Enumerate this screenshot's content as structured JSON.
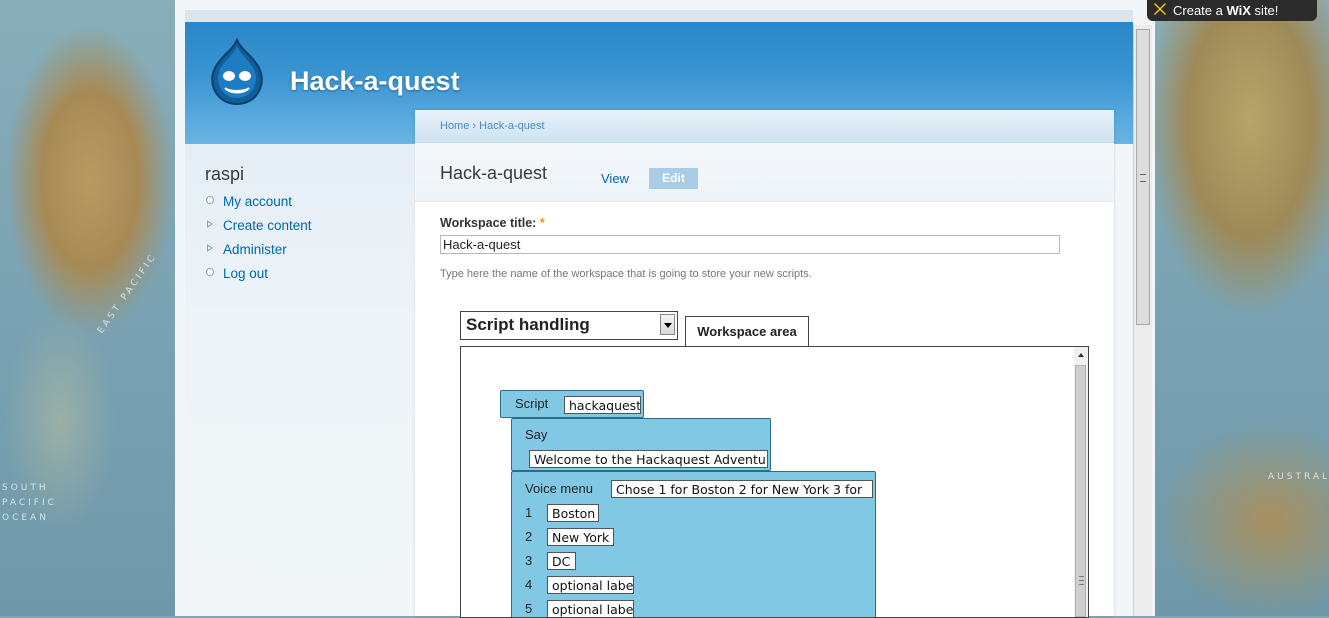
{
  "site": {
    "name": "Hack-a-quest"
  },
  "wix_badge": {
    "prefix": "Create a ",
    "brand": "WiX",
    "suffix": " site!"
  },
  "map_labels": [
    "SOUTH",
    "PACIFIC",
    "OCEAN",
    "EAST PACIFIC",
    "AUSTRALIA"
  ],
  "sidebar": {
    "user": "raspi",
    "items": [
      {
        "label": "My account",
        "bullet": "circle"
      },
      {
        "label": "Create content",
        "bullet": "triangle"
      },
      {
        "label": "Administer",
        "bullet": "triangle"
      },
      {
        "label": "Log out",
        "bullet": "circle"
      }
    ]
  },
  "breadcrumb": {
    "home": "Home",
    "separator": "›",
    "current": "Hack-a-quest"
  },
  "page": {
    "title": "Hack-a-quest",
    "tabs": {
      "view": "View",
      "edit": "Edit"
    }
  },
  "form": {
    "workspace_title_label": "Workspace title:",
    "required_mark": "*",
    "workspace_title_value": "Hack-a-quest",
    "workspace_title_description": "Type here the name of the workspace that is going to store your new scripts."
  },
  "editor": {
    "category_selected": "Script handling",
    "workspace_tab": "Workspace area",
    "blocks": {
      "script_label": "Script",
      "script_name": "hackaquest",
      "say_label": "Say",
      "say_text": "Welcome to the Hackaquest Adventu",
      "voice_menu_label": "Voice menu",
      "voice_menu_prompt": "Chose 1 for Boston 2 for New York 3 for",
      "options": [
        {
          "key": "1",
          "label": "Boston"
        },
        {
          "key": "2",
          "label": "New York"
        },
        {
          "key": "3",
          "label": "DC"
        },
        {
          "key": "4",
          "label": "optional labe"
        },
        {
          "key": "5",
          "label": "optional labe"
        }
      ]
    }
  },
  "colors": {
    "header_blue": "#2a87c8",
    "link_blue": "#0066aa",
    "block_fill": "#80c8e4",
    "edit_tab": "#a9cde6"
  }
}
